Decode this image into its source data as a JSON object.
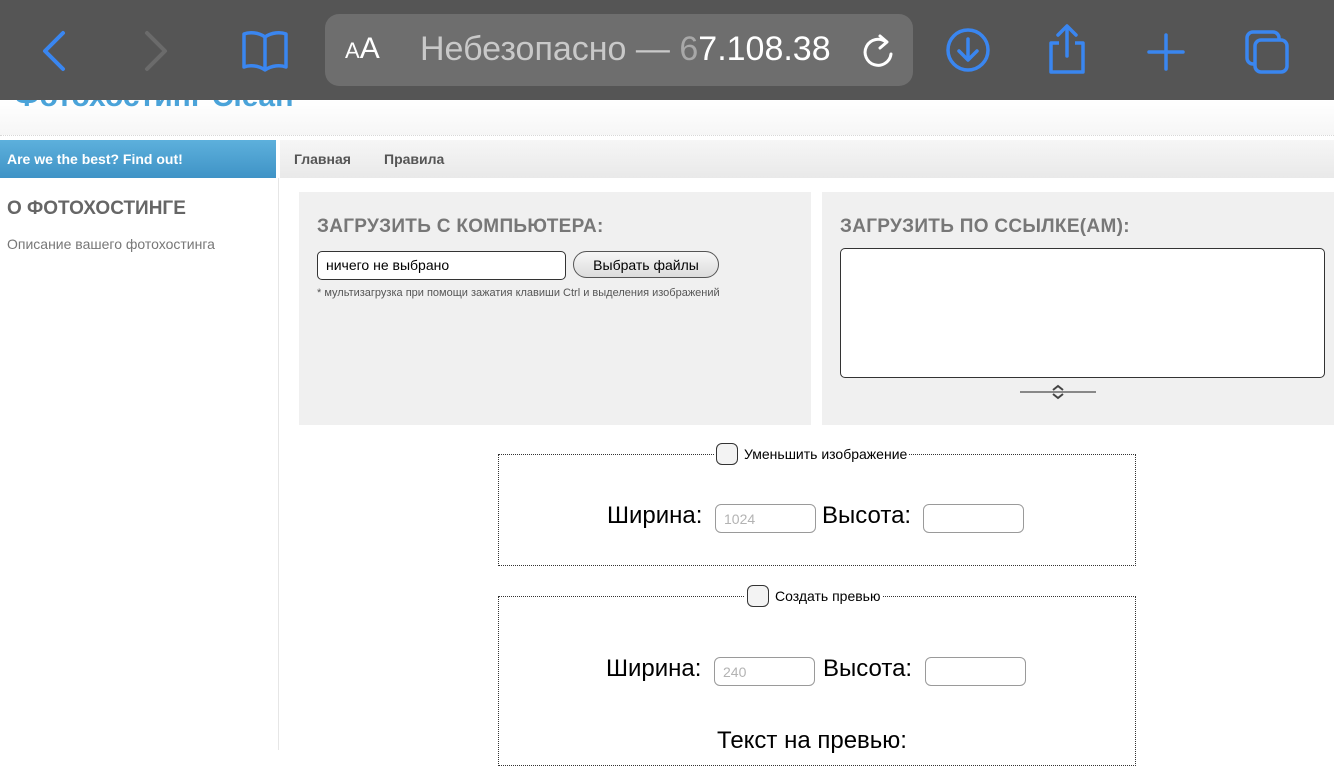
{
  "browser": {
    "aa_small": "A",
    "aa_big": "A",
    "url_prefix": "Небезопасно — ",
    "url_host_faded": "6",
    "url_host": "7.108.38",
    "icons": [
      "back-icon",
      "forward-icon",
      "bookmarks-icon",
      "reader-text-size-icon",
      "reload-icon",
      "downloads-icon",
      "share-icon",
      "new-tab-icon",
      "tabs-icon"
    ],
    "accent_color": "#3a86f0"
  },
  "header": {
    "site_title": "Фотохостинг Clean"
  },
  "banner": {
    "text": "Are we the best? Find out!"
  },
  "nav": {
    "items": [
      "Главная",
      "Правила"
    ]
  },
  "sidebar": {
    "title": "О ФОТОХОСТИНГЕ",
    "description": "Описание вашего фотохостинга"
  },
  "upload_computer": {
    "title": "ЗАГРУЗИТЬ С КОМПЬЮТЕРА:",
    "file_value": "ничего не выбрано",
    "button_label": "Выбрать файлы",
    "hint": "* мультизагрузка при помощи зажатия клавиши Ctrl и выделения изображений"
  },
  "upload_url": {
    "title": "ЗАГРУЗИТЬ ПО ССЫЛКЕ(АМ):"
  },
  "resize": {
    "legend": "Уменьшить изображение",
    "width_label": "Ширина:",
    "width_placeholder": "1024",
    "height_label": "Высота:",
    "height_placeholder": ""
  },
  "preview": {
    "legend": "Создать превью",
    "width_label": "Ширина:",
    "width_placeholder": "240",
    "height_label": "Высота:",
    "height_placeholder": "",
    "text_label": "Текст на превью:"
  }
}
